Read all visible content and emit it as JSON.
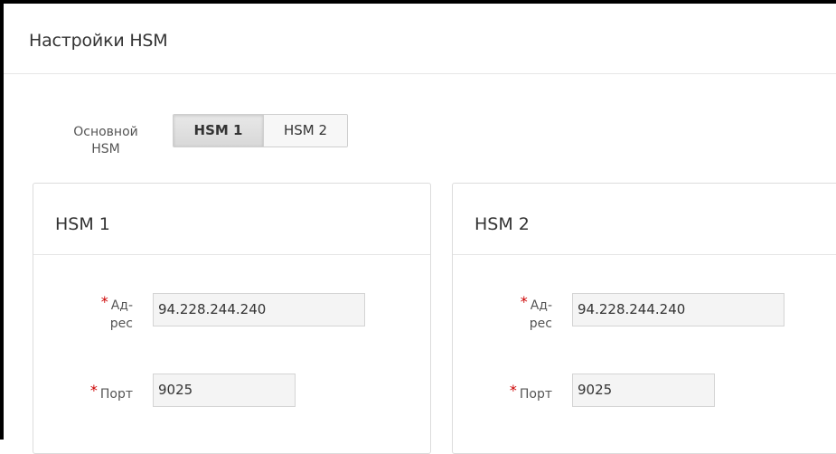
{
  "header": {
    "title": "Настройки HSM"
  },
  "primary_hsm": {
    "label_line1": "Основной",
    "label_line2": "HSM",
    "options": [
      "HSM 1",
      "HSM 2"
    ],
    "selected": "HSM 1"
  },
  "panels": [
    {
      "title": "HSM 1",
      "address_label_line1": "Ад-",
      "address_label_line2": "рес",
      "address_value": "94.228.244.240",
      "port_label": "Порт",
      "port_value": "9025"
    },
    {
      "title": "HSM 2",
      "address_label_line1": "Ад-",
      "address_label_line2": "рес",
      "address_value": "94.228.244.240",
      "port_label": "Порт",
      "port_value": "9025"
    }
  ],
  "required_marker": "*",
  "colors": {
    "required": "#cc0000",
    "selected_segment": "#dcdcdc",
    "input_background": "#f4f4f4"
  }
}
